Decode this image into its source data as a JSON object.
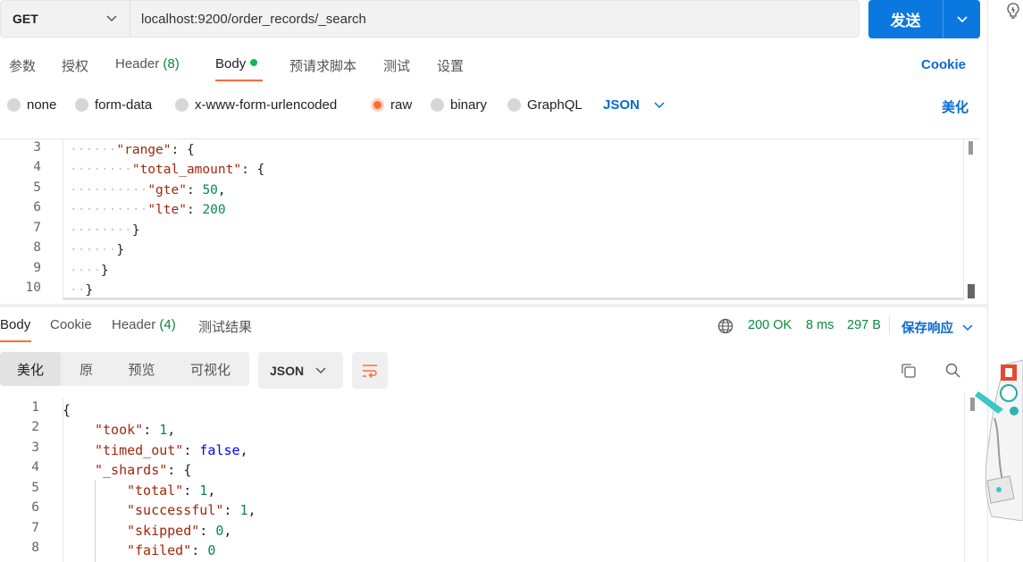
{
  "request": {
    "method": "GET",
    "url": "localhost:9200/order_records/_search",
    "send_label": "发送"
  },
  "request_tabs": [
    {
      "label": "参数"
    },
    {
      "label": "授权"
    },
    {
      "label": "Header",
      "count": "(8)"
    },
    {
      "label": "Body"
    },
    {
      "label": "预请求脚本"
    },
    {
      "label": "测试"
    },
    {
      "label": "设置"
    }
  ],
  "cookie_label": "Cookie",
  "body_types": [
    {
      "label": "none"
    },
    {
      "label": "form-data"
    },
    {
      "label": "x-www-form-urlencoded"
    },
    {
      "label": "raw"
    },
    {
      "label": "binary"
    },
    {
      "label": "GraphQL"
    }
  ],
  "body_format": "JSON",
  "beautify_label": "美化",
  "editor": {
    "line_numbers": [
      "3",
      "4",
      "5",
      "6",
      "7",
      "8",
      "9",
      "10"
    ],
    "t_range": "\"range\"",
    "t_total_amount": "\"total_amount\"",
    "t_gte": "\"gte\"",
    "v_gte": "50",
    "t_lte": "\"lte\"",
    "v_lte": "200"
  },
  "response_tabs": [
    {
      "label": "Body"
    },
    {
      "label": "Cookie"
    },
    {
      "label": "Header",
      "count": "(4)"
    },
    {
      "label": "测试结果"
    }
  ],
  "response_status": {
    "status": "200 OK",
    "time": "8 ms",
    "size": "297 B",
    "save_label": "保存响应"
  },
  "view_modes": [
    "美化",
    "原",
    "预览",
    "可视化"
  ],
  "response_format": "JSON",
  "response": {
    "line_numbers": [
      "1",
      "2",
      "3",
      "4",
      "5",
      "6",
      "7",
      "8"
    ],
    "k_took": "\"took\"",
    "v_took": "1",
    "k_timed_out": "\"timed_out\"",
    "v_timed_out": "false",
    "k_shards": "\"_shards\"",
    "k_total": "\"total\"",
    "v_total": "1",
    "k_successful": "\"successful\"",
    "v_successful": "1",
    "k_skipped": "\"skipped\"",
    "v_skipped": "0",
    "k_failed": "\"failed\"",
    "v_failed": "0"
  },
  "colors": {
    "accent": "#ff6c37",
    "primary": "#0b78e0",
    "link": "#0a6ad0",
    "status_green": "#0a8a3a"
  },
  "icons": [
    "chevron-down-icon",
    "lightbulb-icon",
    "globe-icon",
    "wrap-lines-icon",
    "copy-icon",
    "search-icon"
  ]
}
